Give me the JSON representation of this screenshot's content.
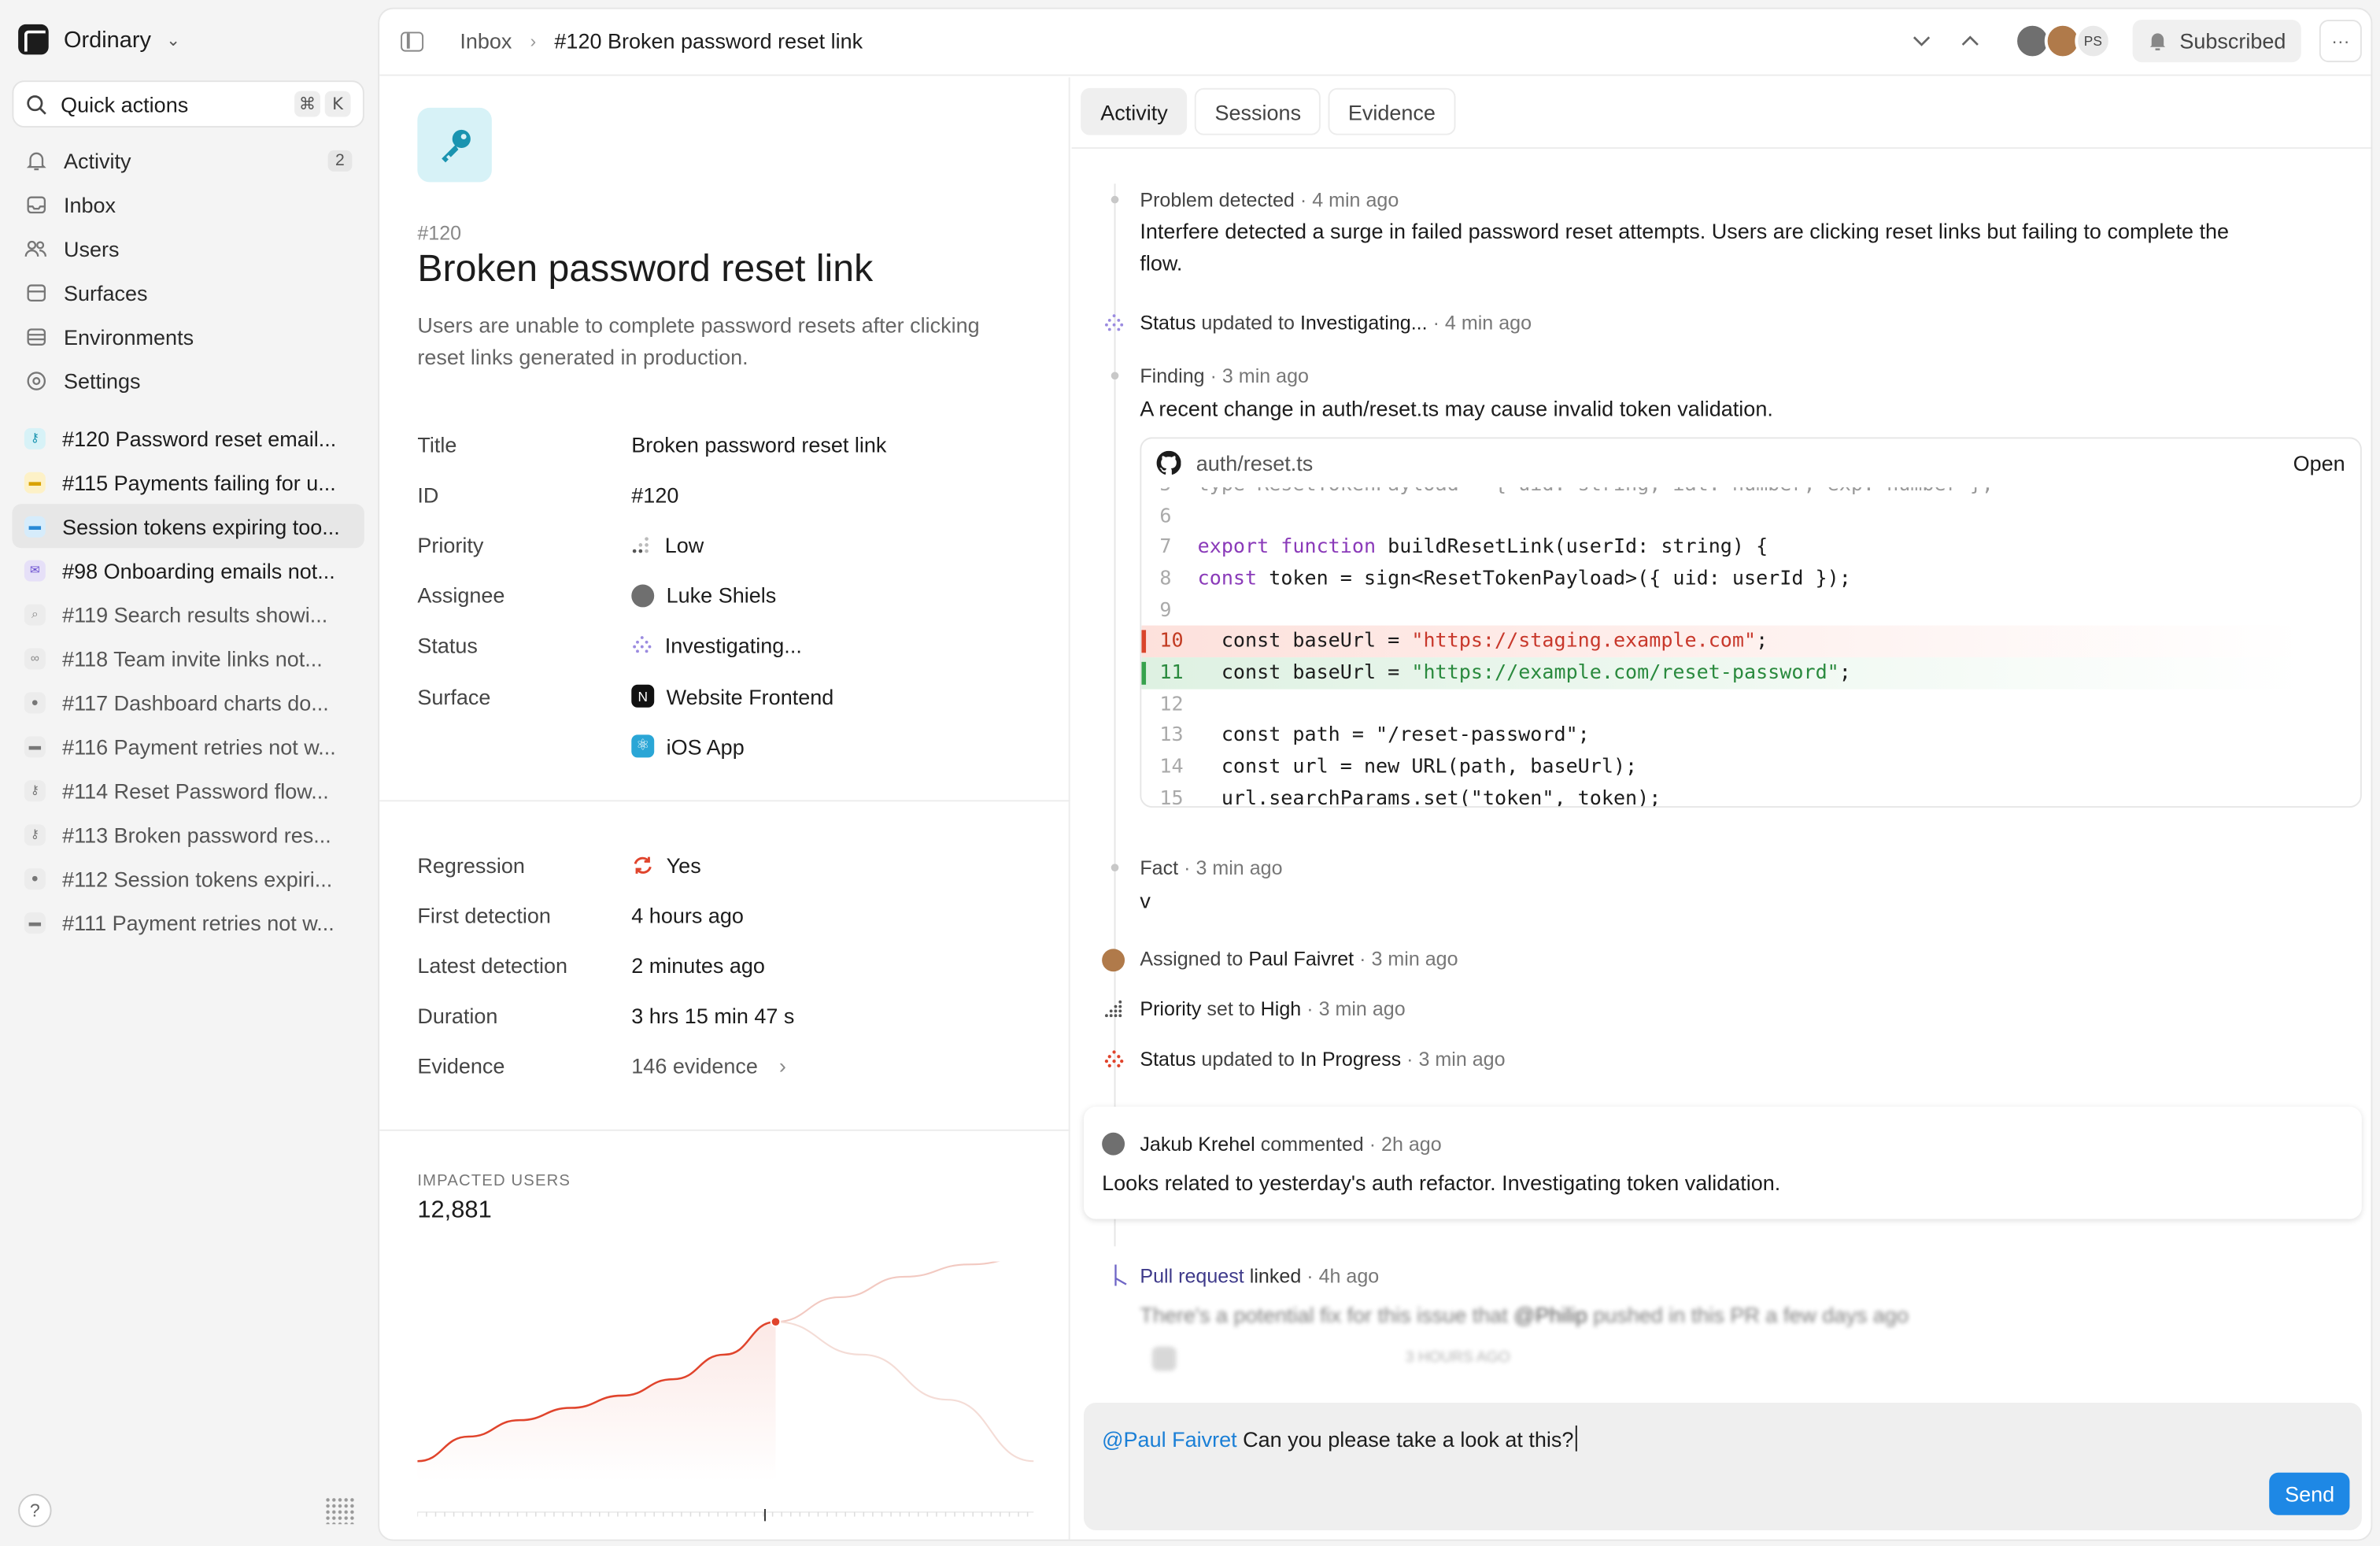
{
  "workspace": {
    "name": "Ordinary"
  },
  "quick_actions": {
    "label": "Quick actions",
    "key1": "⌘",
    "key2": "K"
  },
  "nav": {
    "activity": {
      "label": "Activity",
      "badge": "2"
    },
    "inbox": {
      "label": "Inbox"
    },
    "users": {
      "label": "Users"
    },
    "surfaces": {
      "label": "Surfaces"
    },
    "environments": {
      "label": "Environments"
    },
    "settings": {
      "label": "Settings"
    }
  },
  "issue_list": [
    {
      "label": "#120 Password reset email...",
      "color": "#d7f2f7"
    },
    {
      "label": "#115 Payments failing for u...",
      "color": "#fdf1c7"
    },
    {
      "label": "Session tokens expiring too...",
      "color": "#d6ecfb"
    },
    {
      "label": "#98 Onboarding emails not...",
      "color": "#e6e0f8"
    },
    {
      "label": "#119 Search results showi...",
      "color": "#ececec"
    },
    {
      "label": "#118 Team invite links not...",
      "color": "#ececec"
    },
    {
      "label": "#117 Dashboard charts do...",
      "color": "#ececec"
    },
    {
      "label": "#116 Payment retries not w...",
      "color": "#ececec"
    },
    {
      "label": "#114 Reset Password flow...",
      "color": "#ececec"
    },
    {
      "label": "#113 Broken password res...",
      "color": "#ececec"
    },
    {
      "label": "#112 Session tokens expiri...",
      "color": "#ececec"
    },
    {
      "label": "#111 Payment retries not w...",
      "color": "#ececec"
    }
  ],
  "help": {
    "label": "?"
  },
  "breadcrumb": {
    "root": "Inbox",
    "current": "#120 Broken password reset link"
  },
  "topbar": {
    "avatar_initials": "PS",
    "subscribed_label": "Subscribed",
    "more": "···"
  },
  "issue": {
    "id": "#120",
    "title": "Broken password reset link",
    "description": "Users are unable to complete password resets after clicking reset links generated in production.",
    "props": {
      "title_k": "Title",
      "title_v": "Broken password reset link",
      "id_k": "ID",
      "id_v": "#120",
      "priority_k": "Priority",
      "priority_v": "Low",
      "assignee_k": "Assignee",
      "assignee_v": "Luke Shiels",
      "status_k": "Status",
      "status_v": "Investigating...",
      "surface_k": "Surface",
      "surface_v1": "Website Frontend",
      "surface_v2": "iOS App"
    },
    "props2": {
      "regression_k": "Regression",
      "regression_v": "Yes",
      "first_k": "First detection",
      "first_v": "4 hours ago",
      "latest_k": "Latest detection",
      "latest_v": "2 minutes ago",
      "duration_k": "Duration",
      "duration_v": "3 hrs 15 min 47 s",
      "evidence_k": "Evidence",
      "evidence_v": "146 evidence"
    },
    "impacted_label": "IMPACTED USERS",
    "impacted_value": "12,881"
  },
  "chart_data": {
    "type": "line",
    "series": [
      {
        "values": [
          0.1,
          0.22,
          0.3,
          0.36,
          0.42,
          0.5,
          0.62,
          0.78
        ]
      },
      {
        "values": [
          0.78,
          0.9,
          1.0,
          1.06,
          1.1
        ]
      },
      {
        "values": [
          0.78,
          0.62,
          0.4,
          0.1
        ]
      }
    ],
    "grid": false
  },
  "tabs": {
    "activity": "Activity",
    "sessions": "Sessions",
    "evidence": "Evidence"
  },
  "activity": {
    "a1_title": "Problem detected",
    "a1_time": "· 4 min ago",
    "a1_body": "Interfere detected a surge in failed password reset attempts. Users are clicking reset links but failing to complete the flow.",
    "a2_k": "Status",
    "a2_mid": "updated to",
    "a2_v": "Investigating...",
    "a2_time": "· 4 min ago",
    "a3_title": "Finding",
    "a3_time": "· 3 min ago",
    "a3_body": "A recent change in auth/reset.ts may cause invalid token validation.",
    "code_file": "auth/reset.ts",
    "code_open": "Open",
    "a4_title": "Fact",
    "a4_time": "· 3 min ago",
    "a4_body": "v",
    "a5_k": "Assigned to",
    "a5_v": "Paul Faivret",
    "a5_time": "· 3 min ago",
    "a6_k": "Priority",
    "a6_mid": "set to",
    "a6_v": "High",
    "a6_time": "· 3 min ago",
    "a7_k": "Status",
    "a7_mid": "updated to",
    "a7_v": "In Progress",
    "a7_time": "· 3 min ago",
    "c_author": "Jakub Krehel",
    "c_mid": "commented",
    "c_time": "· 2h ago",
    "c_body": "Looks related to yesterday's auth refactor. Investigating token validation.",
    "pr_k": "Pull request",
    "pr_mid": "linked",
    "pr_time": "· 4h ago",
    "pr_body_a": "There's a potential fix for this issue that",
    "pr_user": "@Philip",
    "pr_body_b": "pushed in this PR a few days ago",
    "pr_meta": "3 HOURS AGO"
  },
  "compose": {
    "mention": "@Paul Faivret",
    "text": " Can you please take a look at this?",
    "send": "Send"
  }
}
